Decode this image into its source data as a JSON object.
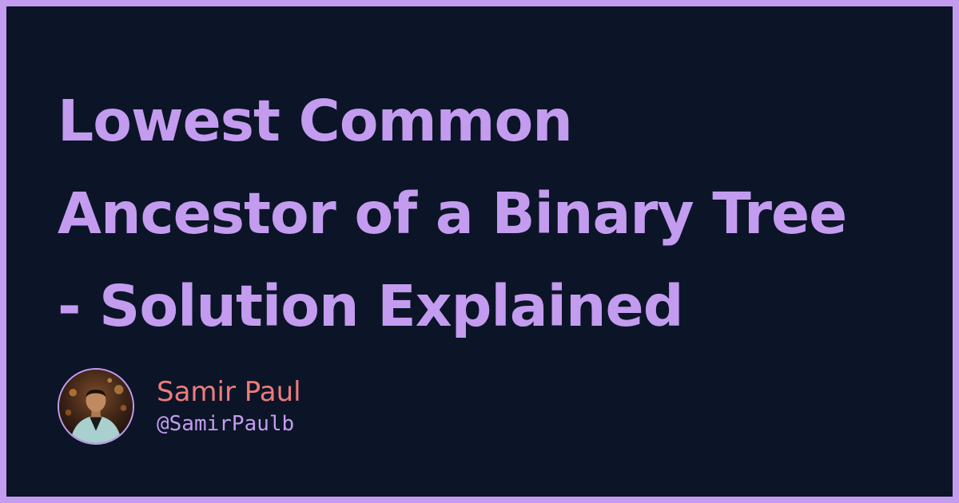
{
  "post": {
    "title_lines": [
      "Lowest Common",
      "Ancestor of a Binary Tree",
      "- Solution Explained"
    ]
  },
  "author": {
    "name": "Samir Paul",
    "handle": "@SamirPaulb"
  },
  "colors": {
    "background": "#0c1527",
    "border": "#c39cf0",
    "title": "#c39cf0",
    "name": "#ef7b7b",
    "handle": "#c39cf0"
  }
}
